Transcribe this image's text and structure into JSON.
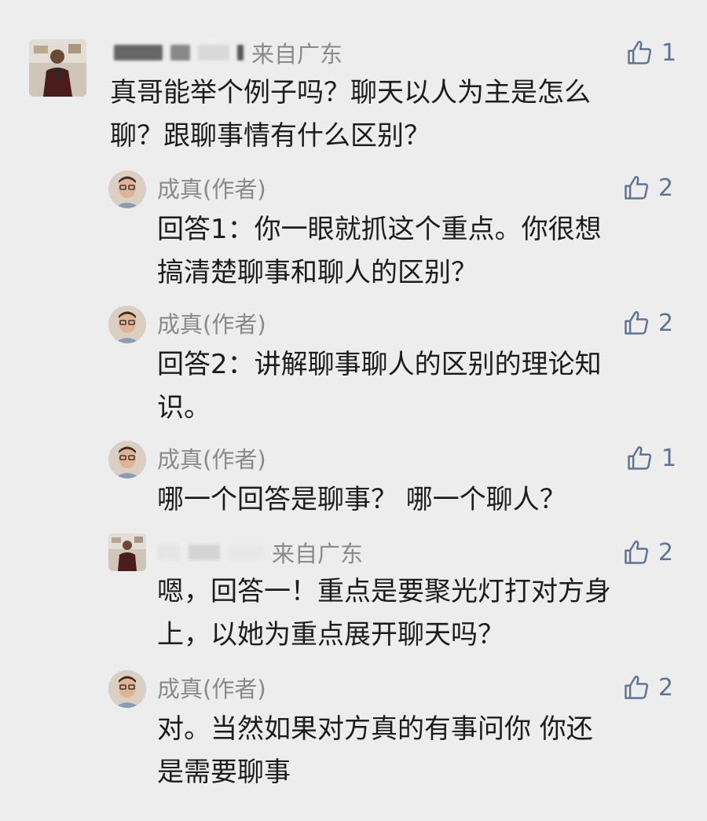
{
  "comments": [
    {
      "location": "来自广东",
      "likes": "1",
      "avatar": "user-photo-avatar",
      "lines": [
        "真哥能举个例子吗？聊天以人为主是怎么",
        "聊？跟聊事情有什么区别？"
      ]
    }
  ],
  "replies": [
    {
      "author": "成真(作者)",
      "likes": "2",
      "avatar": "author-avatar",
      "lines": [
        "回答1：你一眼就抓这个重点。你很想",
        "搞清楚聊事和聊人的区别？"
      ]
    },
    {
      "author": "成真(作者)",
      "likes": "2",
      "avatar": "author-avatar",
      "lines": [
        "回答2：讲解聊事聊人的区别的理论知",
        "识。"
      ]
    },
    {
      "author": "成真(作者)",
      "likes": "1",
      "avatar": "author-avatar",
      "lines": [
        "哪一个回答是聊事？ 哪一个聊人？"
      ]
    },
    {
      "location": "来自广东",
      "likes": "2",
      "avatar": "user-photo-avatar",
      "lines": [
        "嗯，回答一！重点是要聚光灯打对方身",
        "上，以她为重点展开聊天吗？"
      ]
    },
    {
      "author": "成真(作者)",
      "likes": "2",
      "avatar": "author-avatar",
      "lines": [
        "对。当然如果对方真的有事问你 你还",
        "是需要聊事"
      ]
    }
  ],
  "colors": {
    "background": "#ededed",
    "name_gray": "#8a8a8a",
    "like_blue": "#5e7493",
    "body_text": "#1c1c1c"
  },
  "icons": {
    "like": "thumbs-up-icon"
  }
}
